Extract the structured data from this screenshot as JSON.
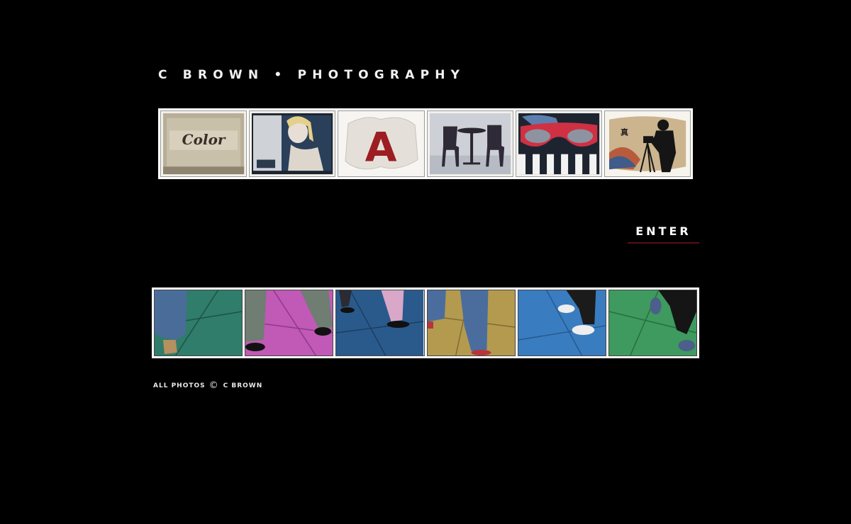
{
  "header": {
    "title": "C BROWN • PHOTOGRAPHY"
  },
  "gallery_top": {
    "items": [
      {
        "name": "color-sign-photo",
        "text": "Color"
      },
      {
        "name": "woman-poster-photo",
        "text": ""
      },
      {
        "name": "red-letter-a-photo",
        "text": "A"
      },
      {
        "name": "chairs-table-photo",
        "text": ""
      },
      {
        "name": "sunglasses-photo",
        "text": ""
      },
      {
        "name": "photographer-silhouette-photo",
        "text": ""
      }
    ]
  },
  "enter": {
    "label": "ENTER",
    "accent": "#5a1010"
  },
  "gallery_bottom": {
    "items": [
      {
        "name": "feet-teal-floor-photo",
        "floor": "#2f7d6a"
      },
      {
        "name": "feet-magenta-floor-photo",
        "floor": "#c159b6"
      },
      {
        "name": "feet-blue-floor-photo",
        "floor": "#2a5a8c"
      },
      {
        "name": "feet-gold-floor-photo",
        "floor": "#b39a4e"
      },
      {
        "name": "feet-sky-blue-floor-photo",
        "floor": "#3a7cc0"
      },
      {
        "name": "feet-green-floor-photo",
        "floor": "#3e9a5e"
      }
    ]
  },
  "footer": {
    "prefix": "ALL PHOTOS",
    "symbol": "©",
    "owner": "C BROWN"
  }
}
